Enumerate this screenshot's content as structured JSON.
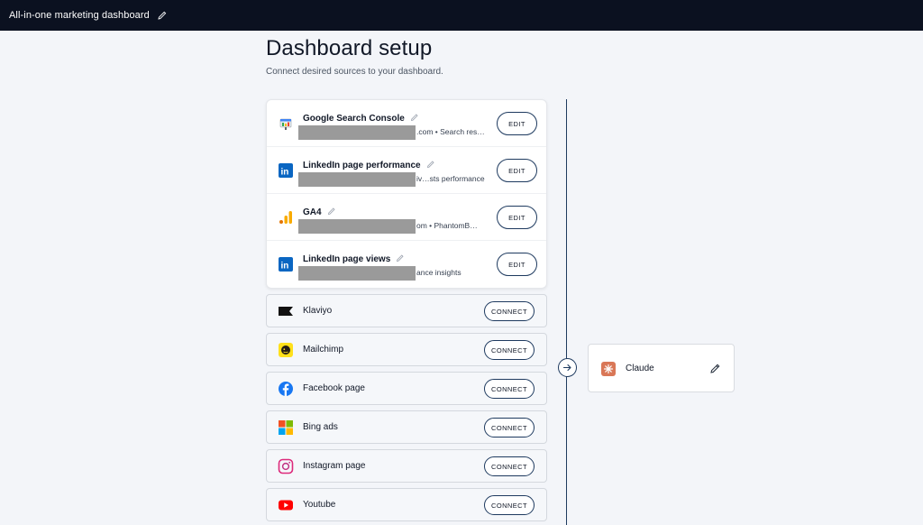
{
  "topbar": {
    "title": "All-in-one marketing dashboard",
    "edit_icon": "pencil-icon"
  },
  "header": {
    "title": "Dashboard setup",
    "subtitle": "Connect desired sources to your dashboard."
  },
  "connected_sources": [
    {
      "name": "Google Search Console",
      "icon": "google-search-console-icon",
      "detail": ".com  •  Search res…",
      "action": "EDIT"
    },
    {
      "name": "LinkedIn page performance",
      "icon": "linkedin-icon",
      "detail": "iv…sts performance",
      "action": "EDIT"
    },
    {
      "name": "GA4",
      "icon": "ga4-icon",
      "detail": "om  •  PhantomB…",
      "action": "EDIT"
    },
    {
      "name": "LinkedIn page views",
      "icon": "linkedin-icon",
      "detail": "ance insights",
      "action": "EDIT"
    }
  ],
  "available_sources": [
    {
      "name": "Klaviyo",
      "icon": "klaviyo-icon",
      "action": "CONNECT"
    },
    {
      "name": "Mailchimp",
      "icon": "mailchimp-icon",
      "action": "CONNECT"
    },
    {
      "name": "Facebook page",
      "icon": "facebook-icon",
      "action": "CONNECT"
    },
    {
      "name": "Bing ads",
      "icon": "microsoft-icon",
      "action": "CONNECT"
    },
    {
      "name": "Instagram page",
      "icon": "instagram-icon",
      "action": "CONNECT"
    },
    {
      "name": "Youtube",
      "icon": "youtube-icon",
      "action": "CONNECT"
    }
  ],
  "destination": {
    "name": "Claude",
    "icon": "claude-icon",
    "edit_icon": "pencil-icon"
  },
  "colors": {
    "topbar": "#0b1120",
    "accent": "#1e3a5f",
    "claude": "#d97757"
  }
}
